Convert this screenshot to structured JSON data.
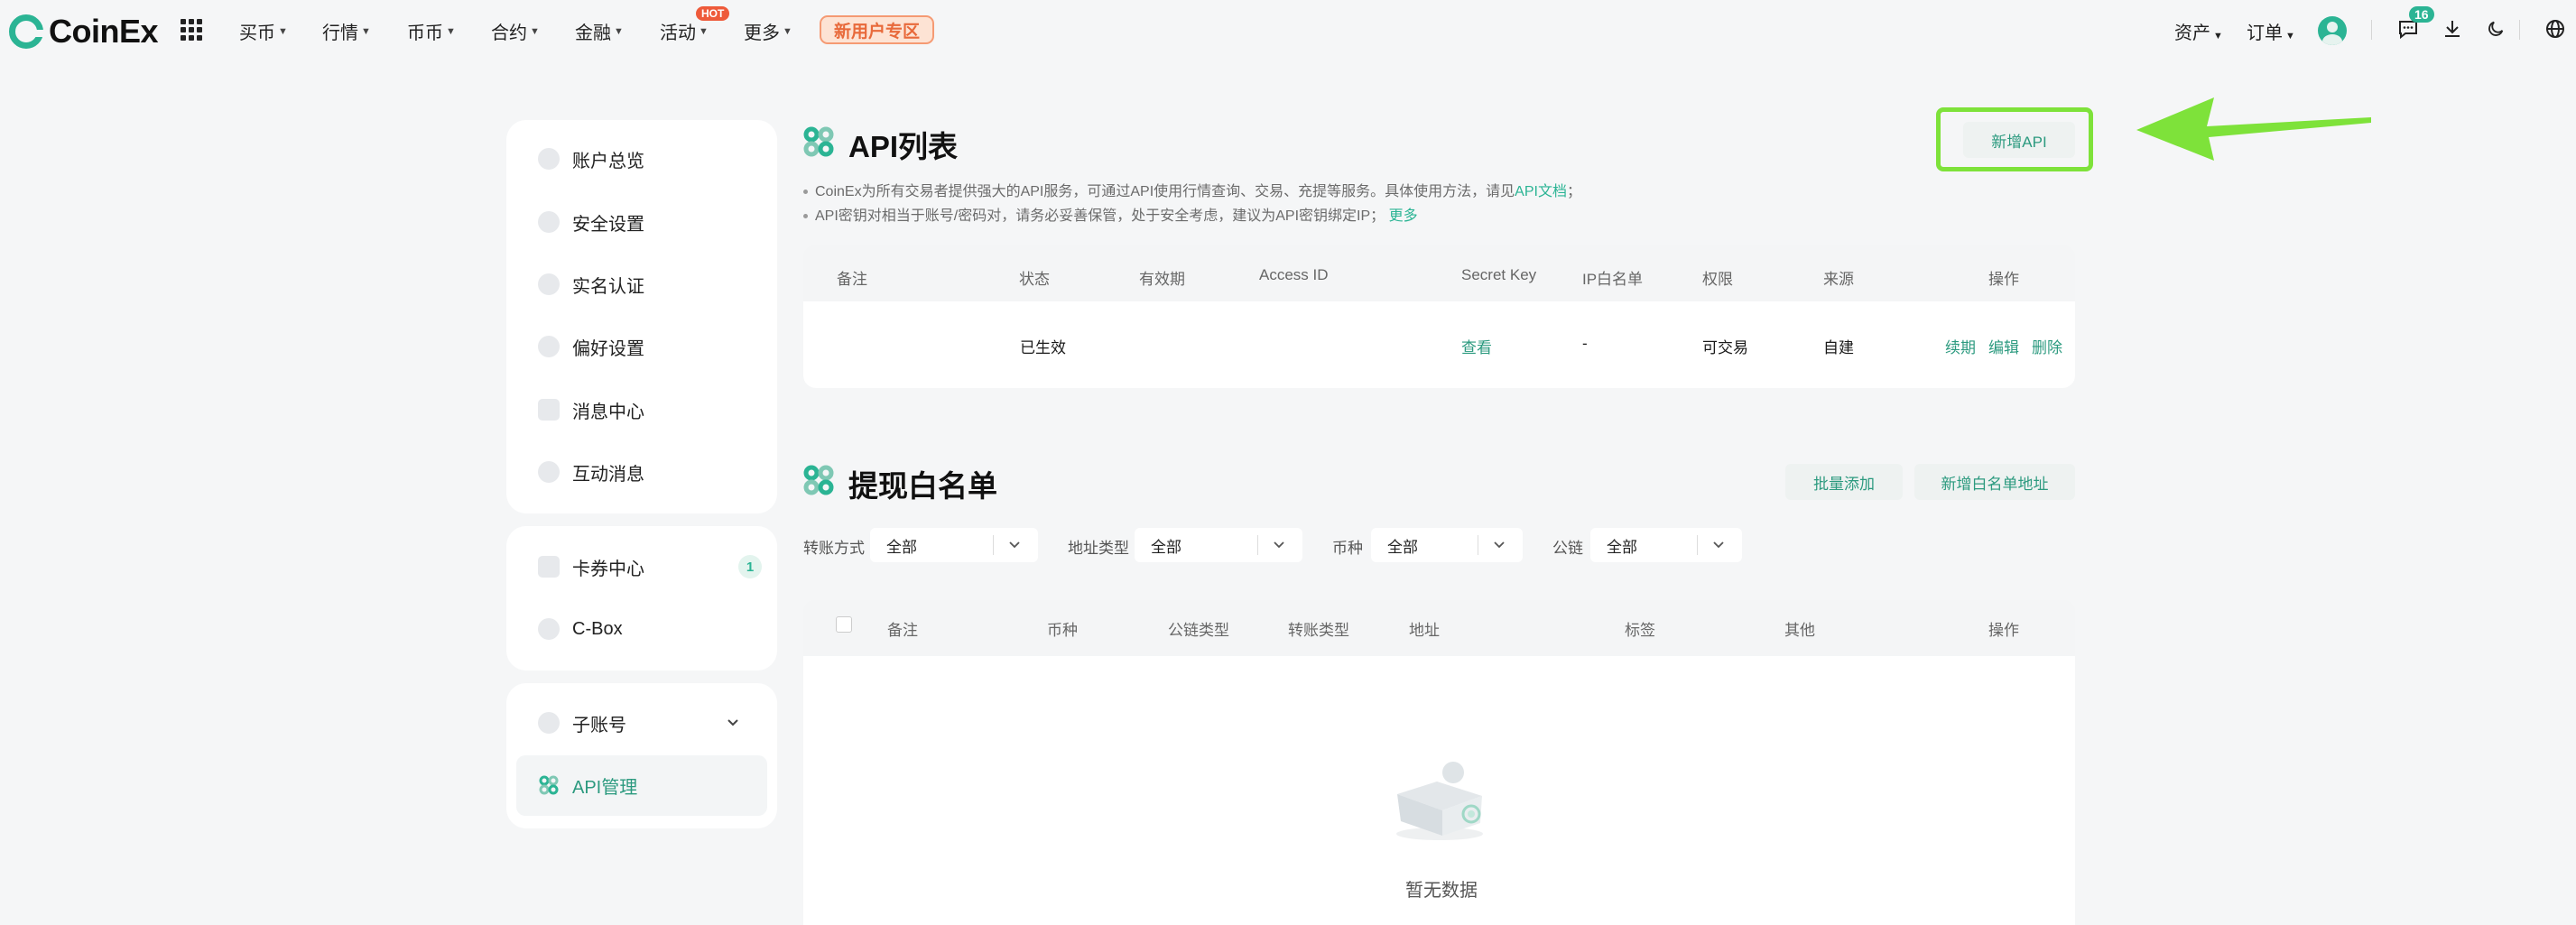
{
  "brand": {
    "name": "CoinEx"
  },
  "nav": {
    "items": [
      "买币",
      "行情",
      "币币",
      "合约",
      "金融",
      "活动",
      "更多"
    ],
    "hot_badge": "HOT",
    "new_user": "新用户专区"
  },
  "topright": {
    "assets": "资产",
    "orders": "订单",
    "notification_count": "16"
  },
  "sidebar": {
    "group1": [
      "账户总览",
      "安全设置",
      "实名认证",
      "偏好设置",
      "消息中心",
      "互动消息"
    ],
    "group2": [
      "卡券中心",
      "C-Box"
    ],
    "coupon_count": "1",
    "group3": [
      "子账号",
      "API管理"
    ]
  },
  "api": {
    "title": "API列表",
    "new_button": "新增API",
    "note1_text": "CoinEx为所有交易者提供强大的API服务，可通过API使用行情查询、交易、充提等服务。具体使用方法，请见",
    "note1_link": "API文档",
    "note1_end": "；",
    "note2_text": "API密钥对相当于账号/密码对，请务必妥善保管，处于安全考虑，建议为API密钥绑定IP；",
    "note2_link": "更多",
    "columns": [
      "备注",
      "状态",
      "有效期",
      "Access ID",
      "Secret Key",
      "IP白名单",
      "权限",
      "来源",
      "操作"
    ],
    "row": {
      "status": "已生效",
      "secret_key": "查看",
      "ip_whitelist": "-",
      "permission": "可交易",
      "source": "自建",
      "actions": [
        "续期",
        "编辑",
        "删除"
      ]
    }
  },
  "whitelist": {
    "title": "提现白名单",
    "batch_add": "批量添加",
    "new_address": "新增白名单地址",
    "filters": [
      {
        "label": "转账方式",
        "value": "全部"
      },
      {
        "label": "地址类型",
        "value": "全部"
      },
      {
        "label": "币种",
        "value": "全部"
      },
      {
        "label": "公链",
        "value": "全部"
      }
    ],
    "columns": [
      "备注",
      "币种",
      "公链类型",
      "转账类型",
      "地址",
      "标签",
      "其他",
      "操作"
    ],
    "empty": "暂无数据"
  },
  "colors": {
    "accent": "#2bb494",
    "highlight": "#7ee23a"
  }
}
